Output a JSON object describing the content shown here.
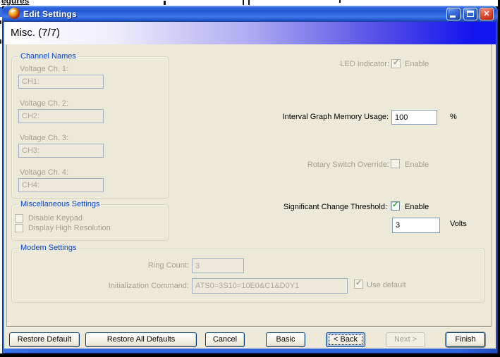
{
  "background": {
    "top_text_fragment": "egures"
  },
  "window": {
    "title": "Edit Settings"
  },
  "icons": {
    "close": "✕",
    "check": "✓"
  },
  "header": {
    "title": "Misc. (7/7)"
  },
  "channel_names": {
    "title": "Channel Names",
    "fields": [
      {
        "label": "Voltage Ch. 1:",
        "value": "CH1:"
      },
      {
        "label": "Voltage Ch. 2:",
        "value": "CH2:"
      },
      {
        "label": "Voltage Ch. 3:",
        "value": "CH3:"
      },
      {
        "label": "Voltage Ch. 4:",
        "value": "CH4:"
      }
    ]
  },
  "misc_settings": {
    "title": "Miscellaneous Settings",
    "options": [
      {
        "label": "Disable Keypad",
        "checked": false,
        "enabled": false
      },
      {
        "label": "Display High Resolution",
        "checked": false,
        "enabled": false
      }
    ]
  },
  "led": {
    "label": "LED Indicator:",
    "option": "Enable",
    "checked": true,
    "enabled": false
  },
  "interval": {
    "label": "Interval Graph Memory Usage:",
    "value": "100",
    "unit": "%"
  },
  "rotary": {
    "label": "Rotary Switch Override:",
    "option": "Enable",
    "checked": false,
    "enabled": false
  },
  "threshold": {
    "label": "Significant Change Threshold:",
    "option": "Enable",
    "checked": true,
    "enabled": true,
    "value": "3",
    "unit": "Volts"
  },
  "modem": {
    "title": "Modem Settings",
    "ring_label": "Ring Count:",
    "ring_value": "3",
    "init_label": "Initialization Command:",
    "init_value": "ATS0=3S10=10E0&C1&D0Y1",
    "use_default_label": "Use default",
    "use_default_checked": true
  },
  "buttons": [
    {
      "label": "Restore Default",
      "state": "normal"
    },
    {
      "label": "Restore All Defaults",
      "state": "normal"
    },
    {
      "label": "Cancel",
      "state": "normal"
    },
    {
      "label": "Basic",
      "state": "normal"
    },
    {
      "label": "< Back",
      "state": "focused"
    },
    {
      "label": "Next >",
      "state": "disabled"
    },
    {
      "label": "Finish",
      "state": "default"
    }
  ],
  "colors": {
    "titlebar_blue": "#2E64DD",
    "header_blue": "#1414EE",
    "face": "#ECE9D8",
    "group_title_blue": "#0646D5",
    "disabled_text": "#A5A192",
    "input_border": "#7F9DB9",
    "check_green": "#23A323",
    "button_border": "#003C74",
    "close_red": "#CC3A1F"
  }
}
